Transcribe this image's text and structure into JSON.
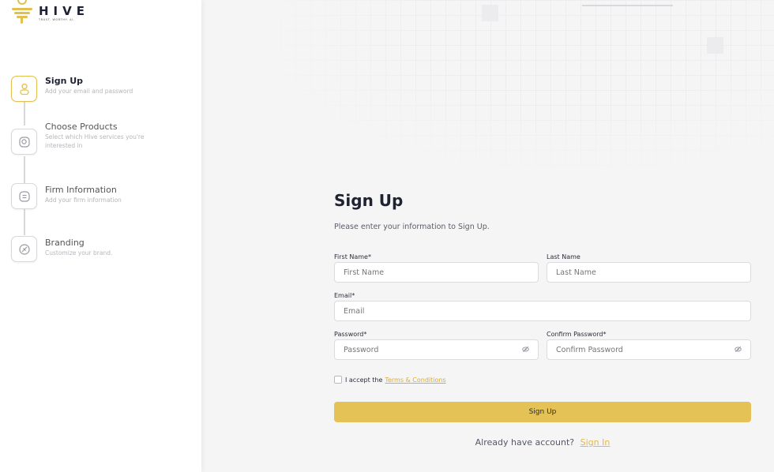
{
  "brand": {
    "name": "HIVE",
    "tagline": "TRUST. WORTHY. AI.",
    "accent": "#e4c255"
  },
  "steps": [
    {
      "title": "Sign Up",
      "desc": "Add your email and password",
      "icon": "user-icon",
      "active": true
    },
    {
      "title": "Choose Products",
      "desc": "Select which Hive services you're interested in",
      "icon": "product-icon",
      "active": false
    },
    {
      "title": "Firm Information",
      "desc": "Add your firm information",
      "icon": "document-icon",
      "active": false
    },
    {
      "title": "Branding",
      "desc": "Customize your brand.",
      "icon": "brush-icon",
      "active": false
    }
  ],
  "form": {
    "title": "Sign Up",
    "subtitle": "Please enter your information to Sign Up.",
    "first_name": {
      "label": "First Name*",
      "placeholder": "First Name",
      "value": ""
    },
    "last_name": {
      "label": "Last Name",
      "placeholder": "Last Name",
      "value": ""
    },
    "email": {
      "label": "Email*",
      "placeholder": "Email",
      "value": ""
    },
    "password": {
      "label": "Password*",
      "placeholder": "Password",
      "value": ""
    },
    "confirm_password": {
      "label": "Confirm Password*",
      "placeholder": "Confirm Password",
      "value": ""
    },
    "terms_prefix": "I accept the",
    "terms_link": "Terms & Conditions",
    "submit_label": "Sign Up",
    "already_text": "Already have account?",
    "signin_link": "Sign In"
  }
}
